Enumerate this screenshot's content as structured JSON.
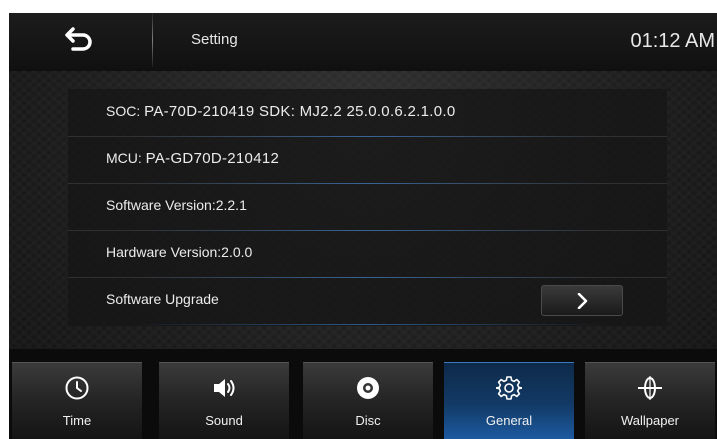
{
  "header": {
    "back_icon": "back-arrow-icon",
    "title": "Setting",
    "clock": "01:12 AM"
  },
  "info_rows": [
    {
      "label": "SOC:",
      "value": "PA-70D-210419  SDK: MJ2.2  25.0.0.6.2.1.0.0"
    },
    {
      "label": "MCU:",
      "value": "PA-GD70D-210412"
    },
    {
      "label": "Software Version:2.2.1"
    },
    {
      "label": "Hardware Version:2.0.0"
    },
    {
      "label": "Software Upgrade",
      "action_icon": "chevron-right-icon"
    }
  ],
  "tabs": [
    {
      "label": "Time",
      "icon": "clock-icon",
      "active": false
    },
    {
      "label": "Sound",
      "icon": "speaker-icon",
      "active": false
    },
    {
      "label": "Disc",
      "icon": "disc-icon",
      "active": false
    },
    {
      "label": "General",
      "icon": "gear-icon",
      "active": true
    },
    {
      "label": "Wallpaper",
      "icon": "wallpaper-icon",
      "active": false
    }
  ],
  "colors": {
    "active_tab": "#1d5aa0",
    "background": "#121212",
    "text": "#ececec"
  }
}
